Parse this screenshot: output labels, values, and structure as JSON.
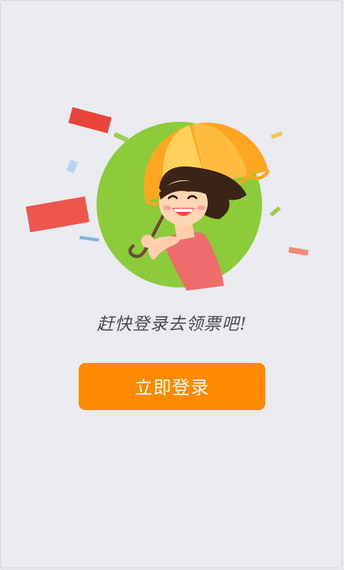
{
  "empty_state": {
    "illustration_icon": "girl-with-umbrella-illustration",
    "message": "赶快登录去领票吧!",
    "login_button_label": "立即登录"
  },
  "colors": {
    "background": "#e9ebf0",
    "accent": "#ff8a00",
    "circle_green": "#8ccc3a",
    "umbrella_orange": "#ffa51f",
    "umbrella_yellow": "#ffd05a"
  }
}
